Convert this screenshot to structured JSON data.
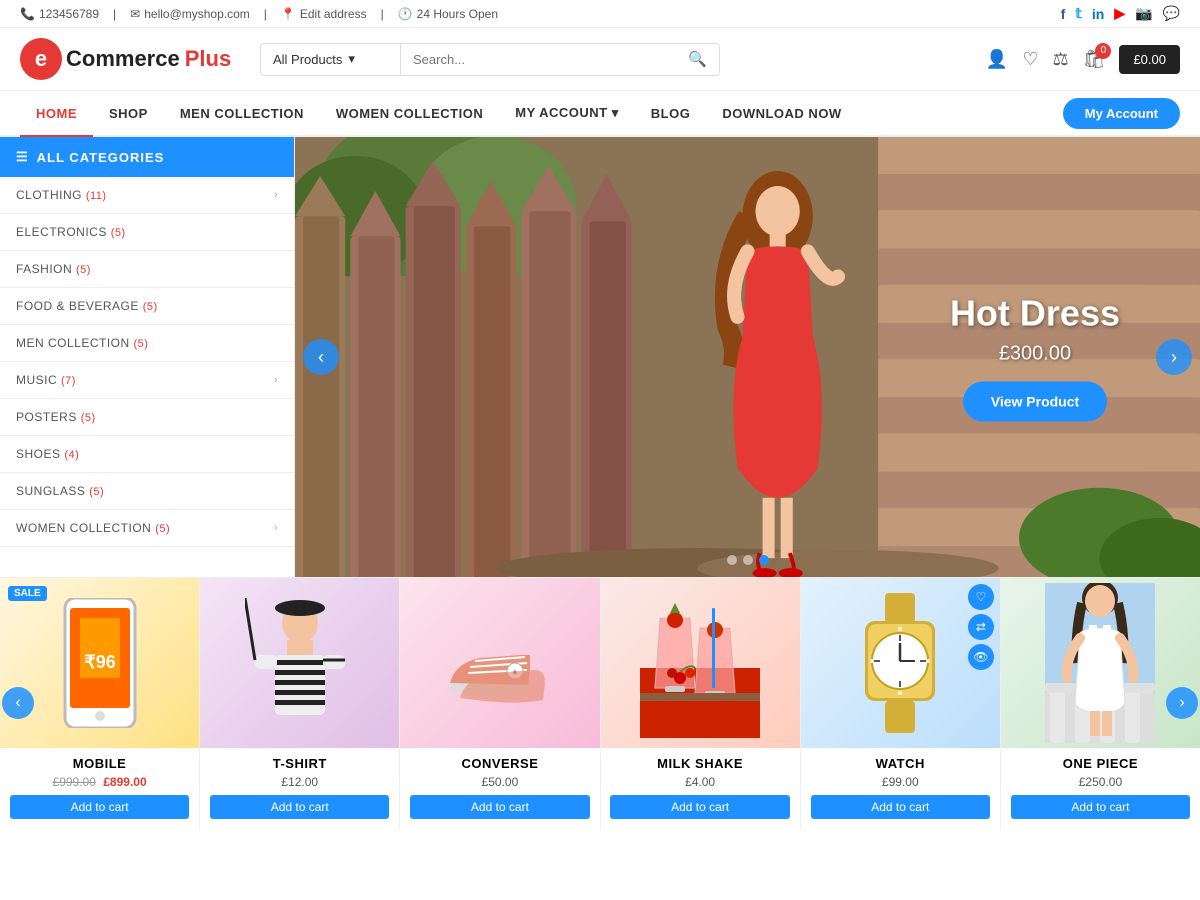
{
  "topbar": {
    "phone": "123456789",
    "email": "hello@myshop.com",
    "address": "Edit address",
    "hours": "24 Hours Open"
  },
  "socials": [
    "facebook",
    "twitter",
    "linkedin",
    "youtube",
    "instagram",
    "whatsapp"
  ],
  "logo": {
    "circle_letter": "e",
    "name": "Commerce",
    "plus": "Plus"
  },
  "search": {
    "category_default": "All Products",
    "placeholder": "Search..."
  },
  "cart": {
    "badge": "0",
    "amount": "£0.00"
  },
  "nav": {
    "items": [
      {
        "label": "HOME",
        "active": true
      },
      {
        "label": "SHOP",
        "active": false
      },
      {
        "label": "MEN COLLECTION",
        "active": false
      },
      {
        "label": "WOMEN COLLECTION",
        "active": false
      },
      {
        "label": "MY ACCOUNT",
        "active": false,
        "has_dropdown": true
      },
      {
        "label": "BLOG",
        "active": false
      },
      {
        "label": "DOWNLOAD NOW",
        "active": false
      }
    ],
    "account_btn": "My Account"
  },
  "sidebar": {
    "header": "ALL CATEGORIES",
    "items": [
      {
        "label": "CLOTHING",
        "count": "11",
        "has_sub": true
      },
      {
        "label": "ELECTRONICS",
        "count": "5",
        "has_sub": false
      },
      {
        "label": "FASHION",
        "count": "5",
        "has_sub": false
      },
      {
        "label": "FOOD & BEVERAGE",
        "count": "5",
        "has_sub": false
      },
      {
        "label": "MEN COLLECTION",
        "count": "5",
        "has_sub": false
      },
      {
        "label": "MUSIC",
        "count": "7",
        "has_sub": true
      },
      {
        "label": "POSTERS",
        "count": "5",
        "has_sub": false
      },
      {
        "label": "SHOES",
        "count": "4",
        "has_sub": false
      },
      {
        "label": "SUNGLASS",
        "count": "5",
        "has_sub": false
      },
      {
        "label": "WOMEN COLLECTION",
        "count": "5",
        "has_sub": true
      }
    ]
  },
  "slider": {
    "title": "Hot Dress",
    "price": "£300.00",
    "btn_label": "View Product",
    "dots": 3,
    "active_dot": 1
  },
  "products": [
    {
      "name": "MOBILE",
      "price_original": "£999.00",
      "price_sale": "£899.00",
      "has_sale_badge": true,
      "color": "phone"
    },
    {
      "name": "T-SHIRT",
      "price": "£12.00",
      "has_sale_badge": false,
      "color": "tshirt"
    },
    {
      "name": "CONVERSE",
      "price": "£50.00",
      "has_sale_badge": false,
      "color": "shoes"
    },
    {
      "name": "MILK SHAKE",
      "price": "£4.00",
      "has_sale_badge": false,
      "color": "drink"
    },
    {
      "name": "WATCH",
      "price": "£99.00",
      "has_sale_badge": false,
      "color": "watch",
      "has_action_icons": true
    },
    {
      "name": "ONE PIECE",
      "price": "£250.00",
      "has_sale_badge": false,
      "color": "dress"
    }
  ],
  "labels": {
    "sale": "SALE",
    "add_to_cart": "Add to cart"
  }
}
